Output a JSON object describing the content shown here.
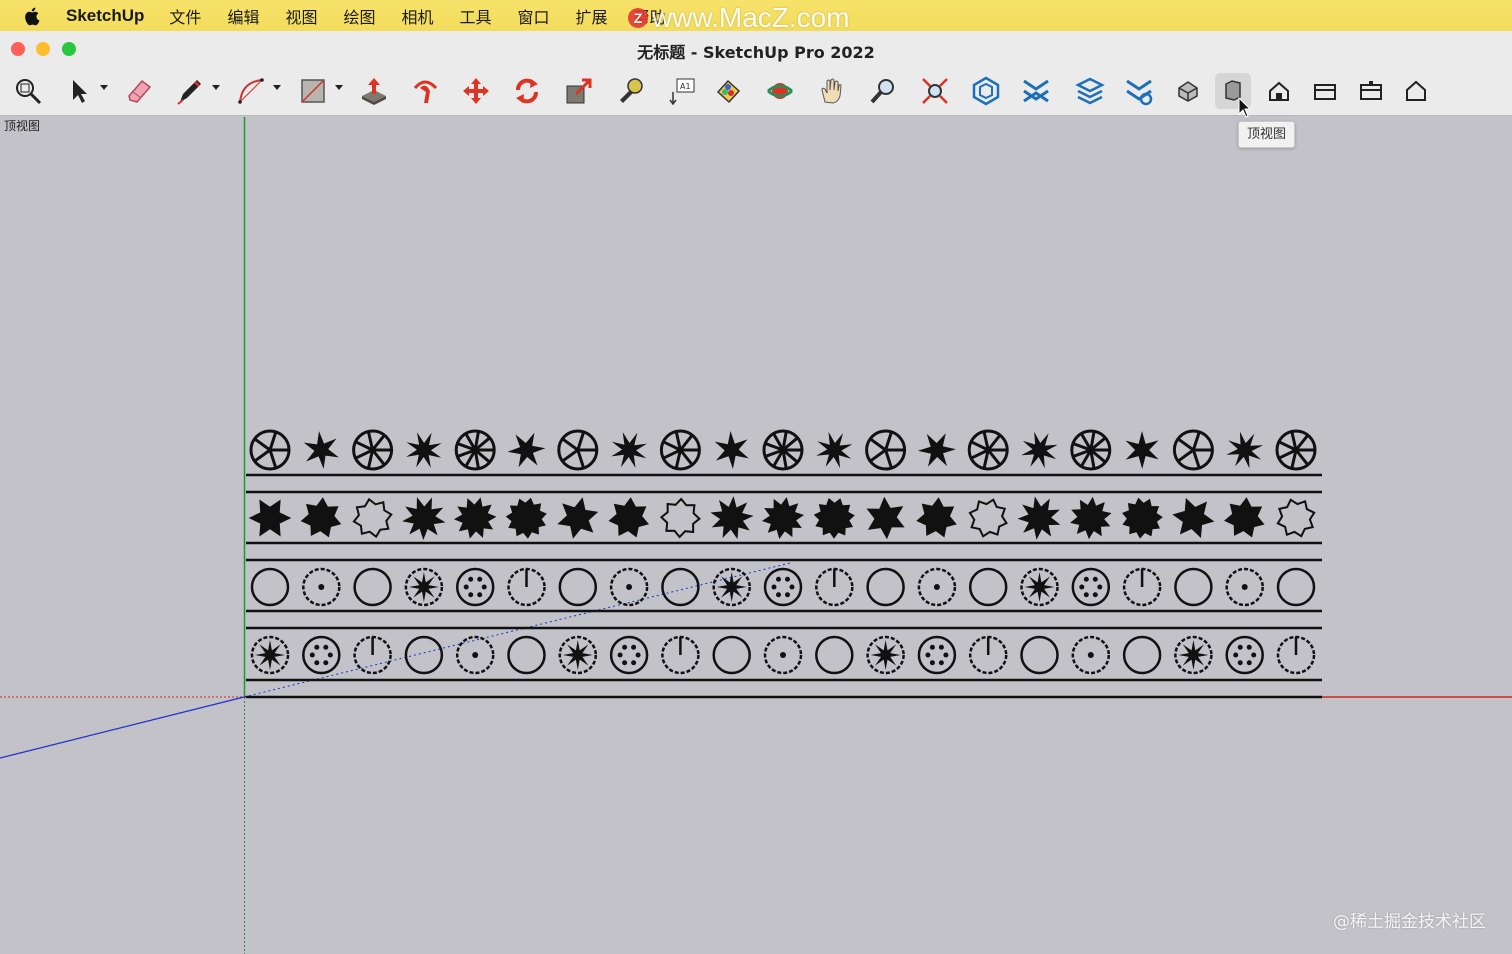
{
  "menubar": {
    "app_name": "SketchUp",
    "items": [
      "文件",
      "编辑",
      "视图",
      "绘图",
      "相机",
      "工具",
      "窗口",
      "扩展",
      "帮助"
    ]
  },
  "watermark_top": "www.MacZ.com",
  "watermark_logo": "Z",
  "window": {
    "title": "无标题 - SketchUp Pro 2022"
  },
  "toolbar": {
    "tools": [
      "zoom-window-icon",
      "select-icon",
      "eraser-icon",
      "line-icon",
      "arc-icon",
      "rectangle-icon",
      "push-pull-icon",
      "follow-me-icon",
      "move-icon",
      "rotate-icon",
      "scale-icon",
      "tape-measure-icon",
      "text-icon",
      "paint-bucket-icon",
      "orbit-icon",
      "pan-icon",
      "zoom-icon",
      "zoom-extents-icon",
      "warehouse-icon",
      "extension-warehouse-icon",
      "layout-icon",
      "extension-manager-icon",
      "iso-view-icon",
      "top-view-icon",
      "front-view-icon",
      "right-view-icon",
      "back-view-icon",
      "left-view-icon"
    ],
    "tooltip": "顶视图"
  },
  "viewport": {
    "scene_label": "顶视图",
    "axis_colors": {
      "red": "#d0281f",
      "green": "#1f9a2f",
      "blue": "#1f2fc8"
    },
    "plant_rows": 4,
    "plants_per_row": 21
  },
  "watermark_bottom": "@稀土掘金技术社区"
}
